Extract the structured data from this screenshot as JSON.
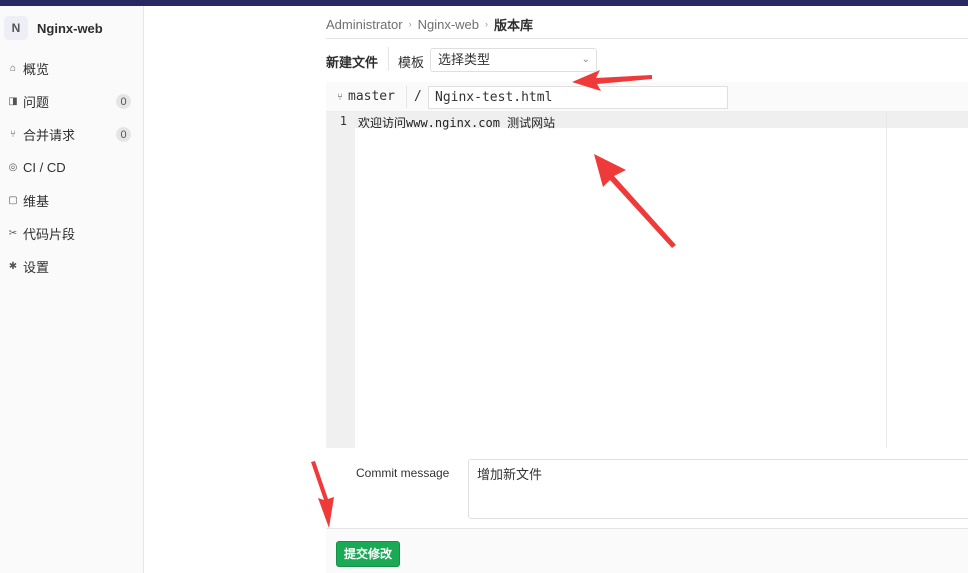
{
  "project": {
    "avatar": "N",
    "name": "Nginx-web"
  },
  "sidebar": {
    "items": [
      {
        "label": "概览",
        "icon": "home-icon",
        "glyph": "⌂"
      },
      {
        "label": "问题",
        "icon": "issues-icon",
        "glyph": "◨",
        "badge": "0"
      },
      {
        "label": "合并请求",
        "icon": "merge-request-icon",
        "glyph": "⑂",
        "badge": "0"
      },
      {
        "label": "CI / CD",
        "icon": "rocket-icon",
        "glyph": "◎"
      },
      {
        "label": "维基",
        "icon": "book-icon",
        "glyph": "▢"
      },
      {
        "label": "代码片段",
        "icon": "scissors-icon",
        "glyph": "✂"
      },
      {
        "label": "设置",
        "icon": "gear-icon",
        "glyph": "✱"
      }
    ]
  },
  "breadcrumb": {
    "items": [
      "Administrator",
      "Nginx-web"
    ],
    "current": "版本库"
  },
  "toolbar": {
    "new_file": "新建文件",
    "template_label": "模板",
    "template_select": "选择类型"
  },
  "editor": {
    "branch": "master",
    "slash": "/",
    "file_name": "Nginx-test.html",
    "lines": [
      {
        "number": "1",
        "text": "欢迎访问www.nginx.com 测试网站"
      }
    ]
  },
  "commit": {
    "label": "Commit message",
    "message": "增加新文件",
    "button": "提交修改"
  },
  "colors": {
    "accent": "#1aaa55",
    "topbar": "#292961",
    "annotation": "#ef3a3a"
  }
}
